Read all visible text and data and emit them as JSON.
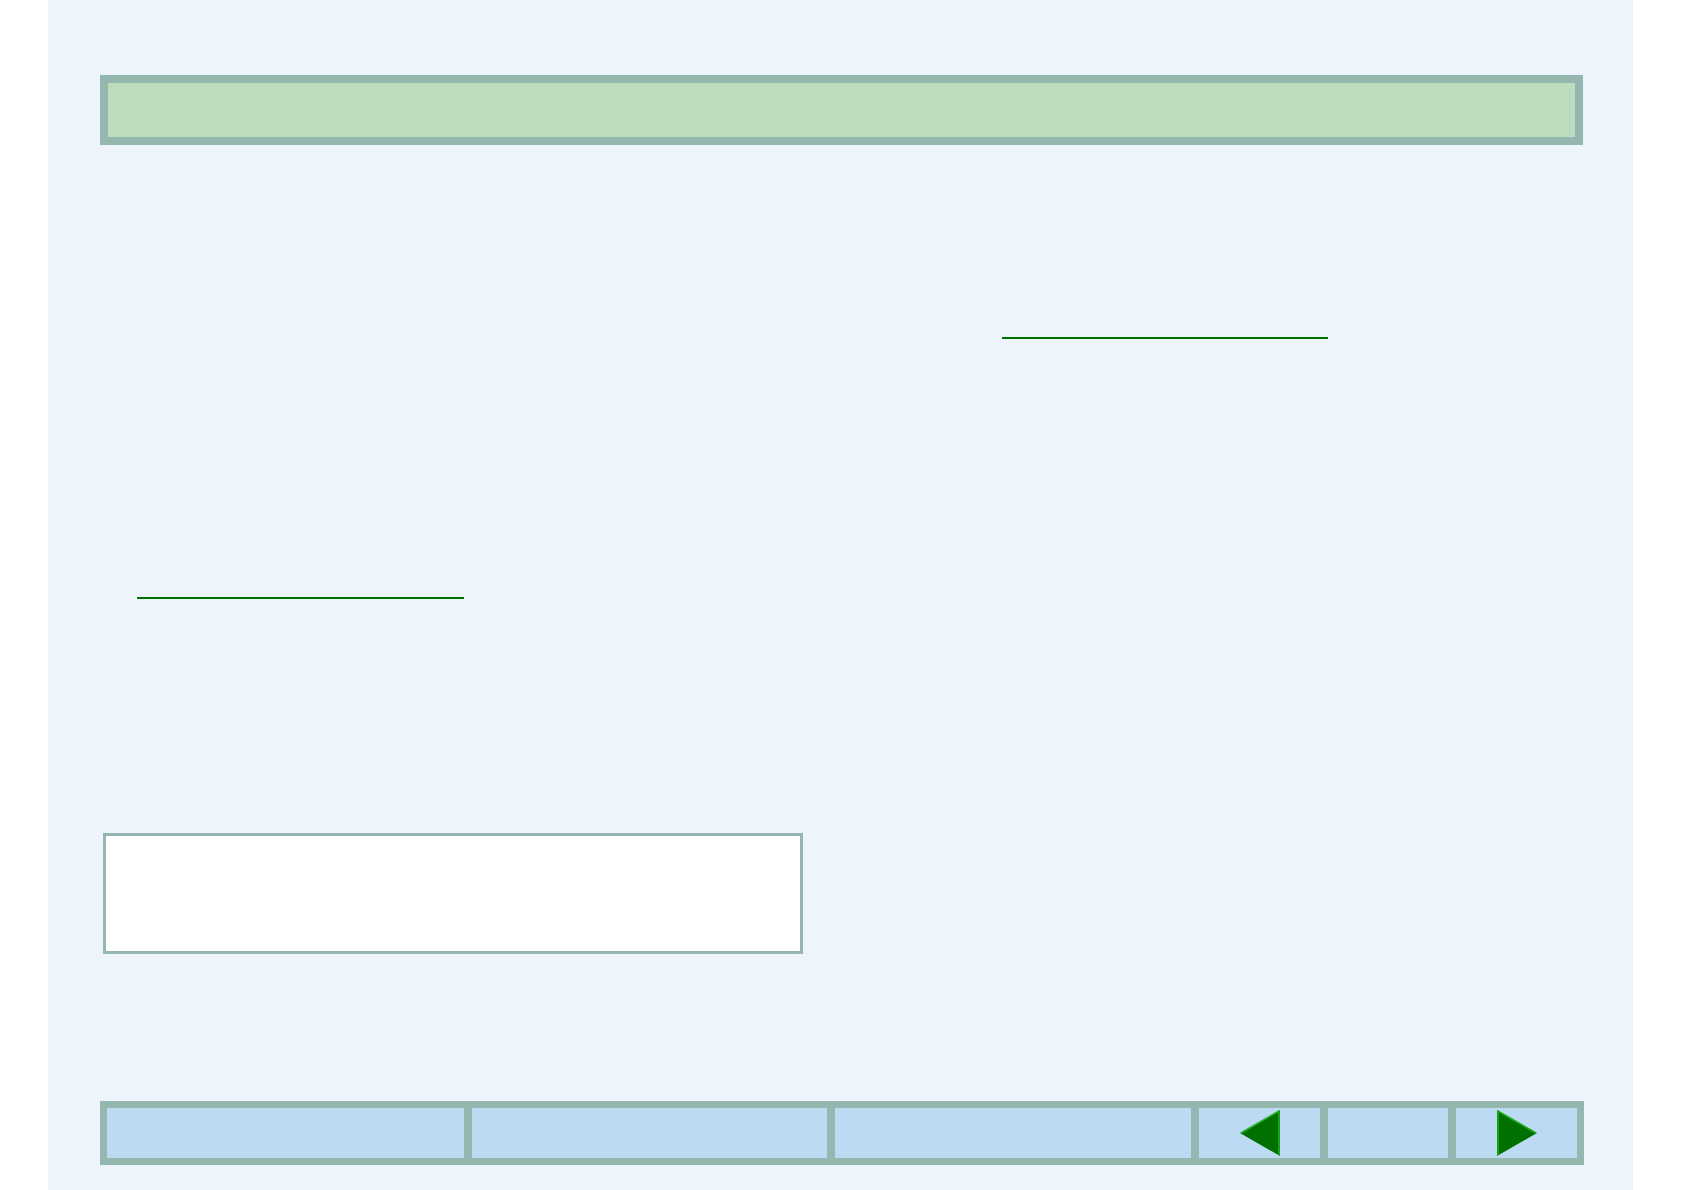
{
  "header_bar": {
    "kind": "banner"
  },
  "links": [
    {
      "kind": "link"
    },
    {
      "kind": "link"
    }
  ],
  "text_box": {
    "kind": "panel"
  },
  "nav_bar": {
    "cells": [
      {
        "kind": "blank"
      },
      {
        "kind": "blank"
      },
      {
        "kind": "blank"
      },
      {
        "kind": "prev"
      },
      {
        "kind": "blank"
      },
      {
        "kind": "next"
      }
    ]
  }
}
